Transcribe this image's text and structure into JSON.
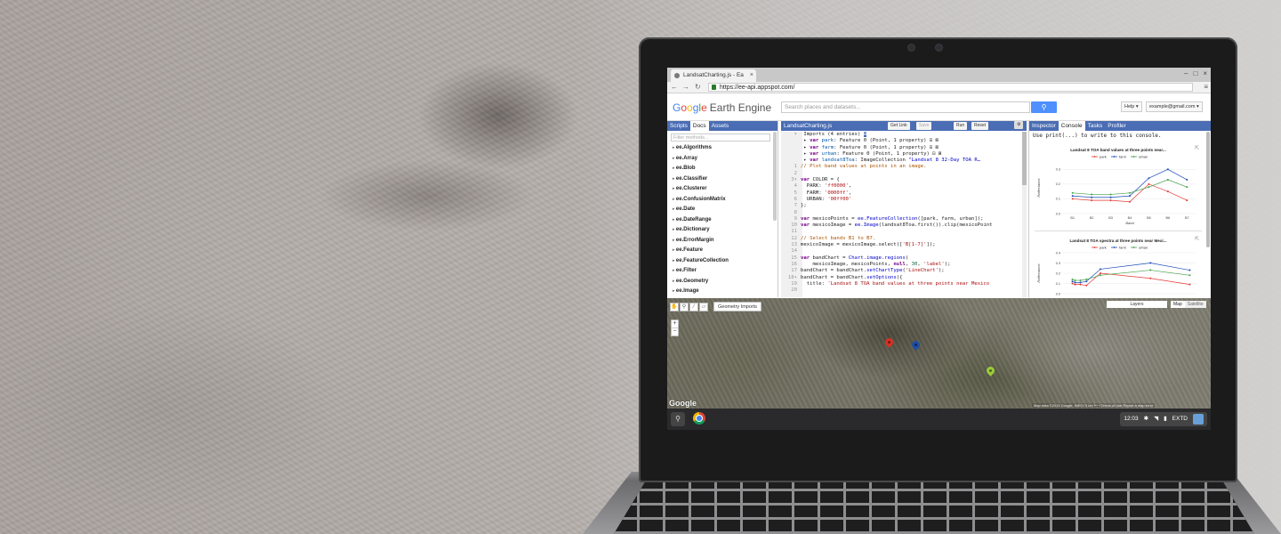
{
  "browser": {
    "tab_title": "LandsatCharting.js - Ea",
    "url": "https://ee-api.appspot.com/"
  },
  "ee": {
    "logo_google": [
      "G",
      "o",
      "o",
      "g",
      "l",
      "e"
    ],
    "logo_product": "Earth Engine",
    "search_placeholder": "Search places and datasets...",
    "help_label": "Help ▾",
    "account_label": "example@gmail.com ▾"
  },
  "left_panel": {
    "tabs": [
      "Scripts",
      "Docs",
      "Assets"
    ],
    "filter_placeholder": "Filter methods...",
    "methods": [
      "ee.Algorithms",
      "ee.Array",
      "ee.Blob",
      "ee.Classifier",
      "ee.Clusterer",
      "ee.ConfusionMatrix",
      "ee.Date",
      "ee.DateRange",
      "ee.Dictionary",
      "ee.ErrorMargin",
      "ee.Feature",
      "ee.FeatureCollection",
      "ee.Filter",
      "ee.Geometry",
      "ee.Image"
    ]
  },
  "editor": {
    "file_name": "LandsatCharting.js",
    "get_link": "Get Link",
    "save": "Save",
    "run": "Run",
    "reset": "Reset"
  },
  "right_panel": {
    "tabs": [
      "Inspector",
      "Console",
      "Tasks",
      "Profiler"
    ],
    "console_hint": "Use print(...) to write to this console."
  },
  "chart_data": [
    {
      "type": "line",
      "title": "Landsat 8 TOA band values at three points near...",
      "xlabel": "Band",
      "ylabel": "Reflectance",
      "categories": [
        "B1",
        "B2",
        "B3",
        "B4",
        "B5",
        "B6",
        "B7"
      ],
      "ylim": [
        0,
        0.35
      ],
      "yticks": [
        "0.0",
        "0.1",
        "0.2",
        "0.3"
      ],
      "legend": "top",
      "series": [
        {
          "name": "park",
          "color": "#e53935",
          "values": [
            0.1,
            0.09,
            0.09,
            0.08,
            0.2,
            0.15,
            0.09
          ]
        },
        {
          "name": "farm",
          "color": "#1e4db7",
          "values": [
            0.12,
            0.11,
            0.11,
            0.12,
            0.24,
            0.3,
            0.23
          ]
        },
        {
          "name": "urban",
          "color": "#43a047",
          "values": [
            0.14,
            0.13,
            0.13,
            0.14,
            0.18,
            0.23,
            0.18
          ]
        }
      ]
    },
    {
      "type": "line",
      "title": "Landsat 8 TOA spectra at three points near Mexi...",
      "ylabel": "Reflectance",
      "x": [
        0.44,
        0.48,
        0.56,
        0.65,
        0.86,
        1.61,
        2.2
      ],
      "ylim": [
        0,
        0.4
      ],
      "yticks": [
        "0.0",
        "0.1",
        "0.2",
        "0.3",
        "0.4"
      ],
      "legend": "top",
      "series": [
        {
          "name": "park",
          "color": "#e53935",
          "values": [
            0.1,
            0.09,
            0.09,
            0.08,
            0.2,
            0.15,
            0.09
          ]
        },
        {
          "name": "farm",
          "color": "#1e4db7",
          "values": [
            0.12,
            0.11,
            0.11,
            0.12,
            0.24,
            0.3,
            0.23
          ]
        },
        {
          "name": "urban",
          "color": "#43a047",
          "values": [
            0.14,
            0.13,
            0.13,
            0.14,
            0.18,
            0.23,
            0.18
          ]
        }
      ]
    }
  ],
  "map": {
    "geometry_imports": "Geometry Imports",
    "layers": "Layers",
    "map_type_map": "Map",
    "map_type_satellite": "Satellite",
    "zoom_in": "+",
    "zoom_out": "−",
    "footer": "Map data ©2015 Google, INEGI   5 km ⊢⊣   Terms of Use   Report a map error",
    "google_logo": "Google",
    "pin_colors": [
      "#d93025",
      "#1f4fa3",
      "#9ccc3a"
    ]
  },
  "shelf": {
    "time": "12:03",
    "extd": "EXTD"
  }
}
